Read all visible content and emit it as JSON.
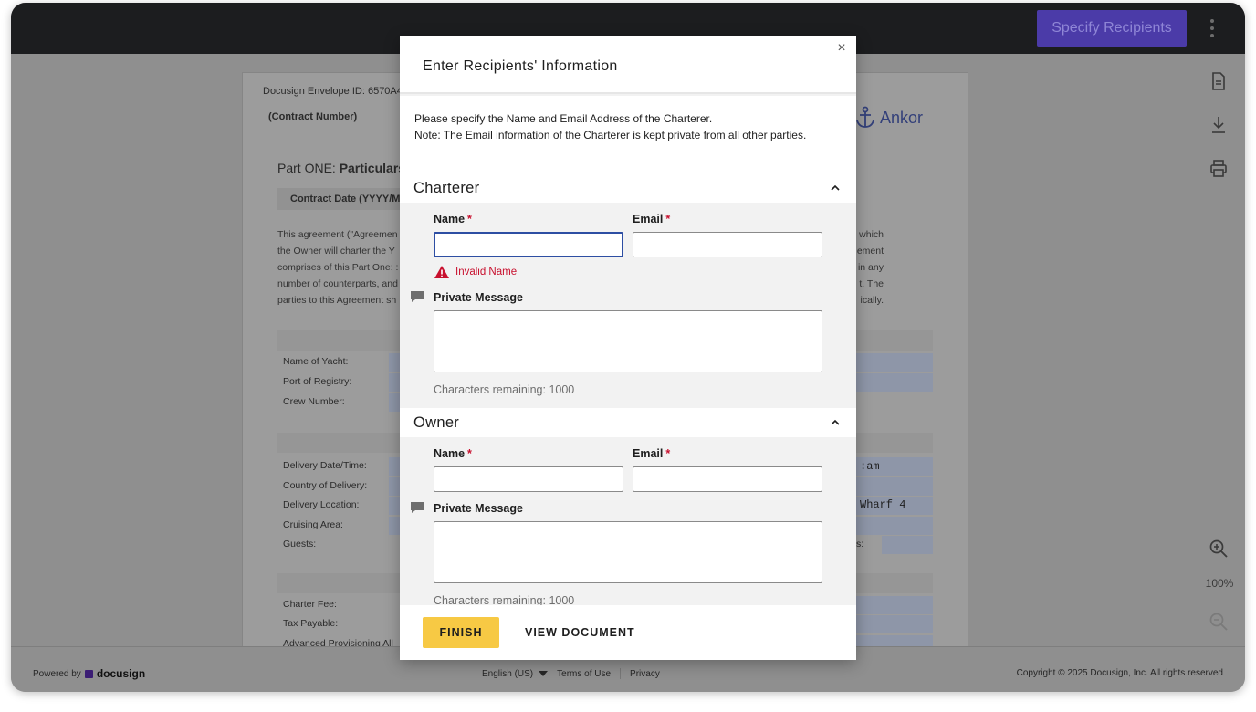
{
  "topbar": {
    "specify_recipients_label": "Specify Recipients",
    "more_menu_icon": "kebab-vertical-icon",
    "accent_color": "#4b3ba8"
  },
  "document": {
    "envelope_id_label": "Docusign Envelope ID: 6570A4",
    "contract_number_label": "(Contract Number)",
    "part_one_prefix": "Part ONE: ",
    "part_one_bold": "Particulars",
    "contract_date_label": "Contract Date (YYYY/MM",
    "paragraph_left": [
      "This agreement (\"Agreemen",
      "the Owner will charter the Y",
      "comprises of this Part One: :",
      "number of counterparts, and",
      "parties to this Agreement sh"
    ],
    "paragraph_right": [
      "which",
      "ement",
      "in any",
      "t. The",
      "ically."
    ],
    "yacht_rows": [
      "Name of Yacht:",
      "Port of Registry:",
      "Crew Number:"
    ],
    "delivery_rows": [
      "Delivery Date/Time:",
      "Country of Delivery:",
      "Delivery Location:",
      "Cruising Area:",
      "Guests:"
    ],
    "fee_rows": [
      "Charter Fee:",
      "Tax Payable:",
      "Advanced Provisioning All"
    ],
    "delivery_time_fragment": ":am",
    "delivery_location_fragment": "Wharf 4",
    "guests_right_fragment": "s:",
    "logo_text": "Ankor"
  },
  "right_tools": {
    "document_icon": "document-icon",
    "download_icon": "download-icon",
    "print_icon": "print-icon",
    "zoom_in_icon": "zoom-in-icon",
    "zoom_level": "100%",
    "zoom_out_icon": "zoom-out-icon"
  },
  "footer": {
    "powered_by": "Powered by",
    "brand": "docusign",
    "language": "English (US)",
    "terms": "Terms of Use",
    "privacy": "Privacy",
    "copyright": "Copyright © 2025 Docusign, Inc. All rights reserved"
  },
  "modal": {
    "title": "Enter Recipients' Information",
    "close_label": "×",
    "intro_line1": "Please specify the Name and Email Address of the Charterer.",
    "intro_line2": "Note: The Email information of the Charterer is kept private from all other parties.",
    "charterer": {
      "heading": "Charterer",
      "name_label": "Name",
      "email_label": "Email",
      "required_mark": "*",
      "name_value": "",
      "email_value": "",
      "error_text": "Invalid Name",
      "private_message_label": "Private Message",
      "chars_remaining": "Characters remaining: 1000"
    },
    "owner": {
      "heading": "Owner",
      "name_label": "Name",
      "email_label": "Email",
      "required_mark": "*",
      "name_value": "",
      "email_value": "",
      "private_message_label": "Private Message",
      "chars_remaining": "Characters remaining: 1000"
    },
    "finish_label": "FINISH",
    "view_document_label": "VIEW DOCUMENT",
    "finish_color": "#f7c944",
    "error_color": "#c8102e"
  }
}
